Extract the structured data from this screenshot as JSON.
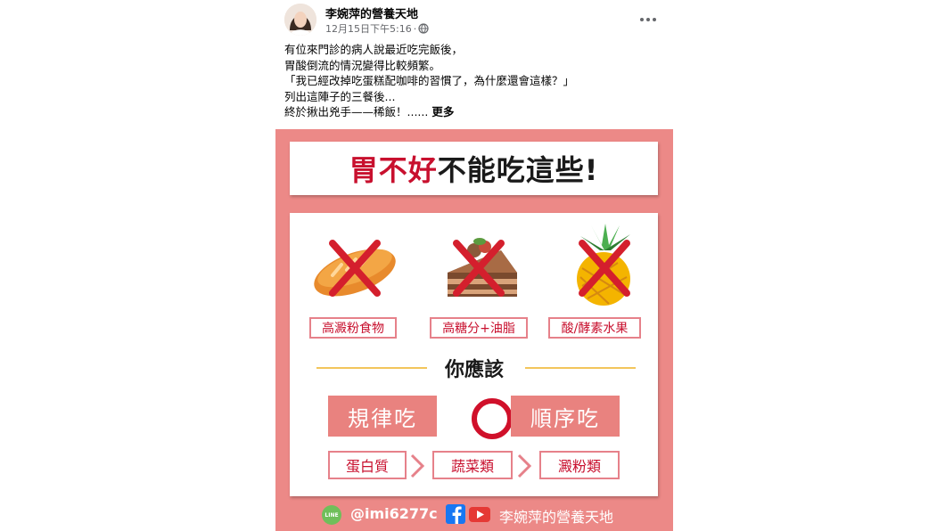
{
  "post": {
    "page_name": "李婉萍的營養天地",
    "timestamp": "12月15日下午5:16",
    "privacy_icon": "globe-icon",
    "more_icon": "more-options-icon",
    "caption_lines": [
      "有位來門診的病人說最近吃完飯後，",
      "胃酸倒流的情況變得比較頻繁。",
      "「我已經改掉吃蛋糕配咖啡的習慣了，為什麼還會這樣？」",
      "列出這陣子的三餐後...",
      "終於揪出兇手——稀飯！......"
    ],
    "see_more": "更多"
  },
  "infographic": {
    "title_red": "胃不好",
    "title_black": "不能吃這些!",
    "foods": [
      {
        "icon": "bread-icon",
        "label": "高澱粉食物"
      },
      {
        "icon": "cake-icon",
        "label": "高糖分+油脂"
      },
      {
        "icon": "pineapple-icon",
        "label": "酸/酵素水果"
      }
    ],
    "section_title": "你應該",
    "actions": [
      "規律吃",
      "順序吃"
    ],
    "steps": [
      "蛋白質",
      "蔬菜類",
      "澱粉類"
    ],
    "footer": {
      "line_label": "LINE",
      "line_id": "@imi6277c",
      "name": "李婉萍的營養天地"
    },
    "colors": {
      "background": "#ec8987",
      "accent_red": "#c8102e",
      "gold_line": "#f2c55c",
      "action_fill": "#e9827f"
    }
  }
}
